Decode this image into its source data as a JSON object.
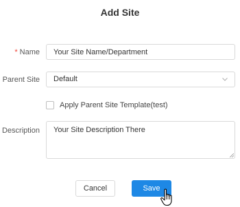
{
  "dialog": {
    "title": "Add Site"
  },
  "form": {
    "name": {
      "required_mark": "*",
      "label": "Name",
      "value": "Your Site Name/Department"
    },
    "parent_site": {
      "label": "Parent Site",
      "selected": "Default"
    },
    "apply_template": {
      "label": "Apply Parent Site Template(test)",
      "checked": false
    },
    "description": {
      "label": "Description",
      "value": "Your Site Description There"
    }
  },
  "actions": {
    "cancel_label": "Cancel",
    "save_label": "Save"
  },
  "colors": {
    "primary": "#1e88e5",
    "required": "#f04134"
  },
  "icons": {
    "select_arrow": "chevron-down-icon",
    "pointer": "hand-pointer-cursor"
  }
}
